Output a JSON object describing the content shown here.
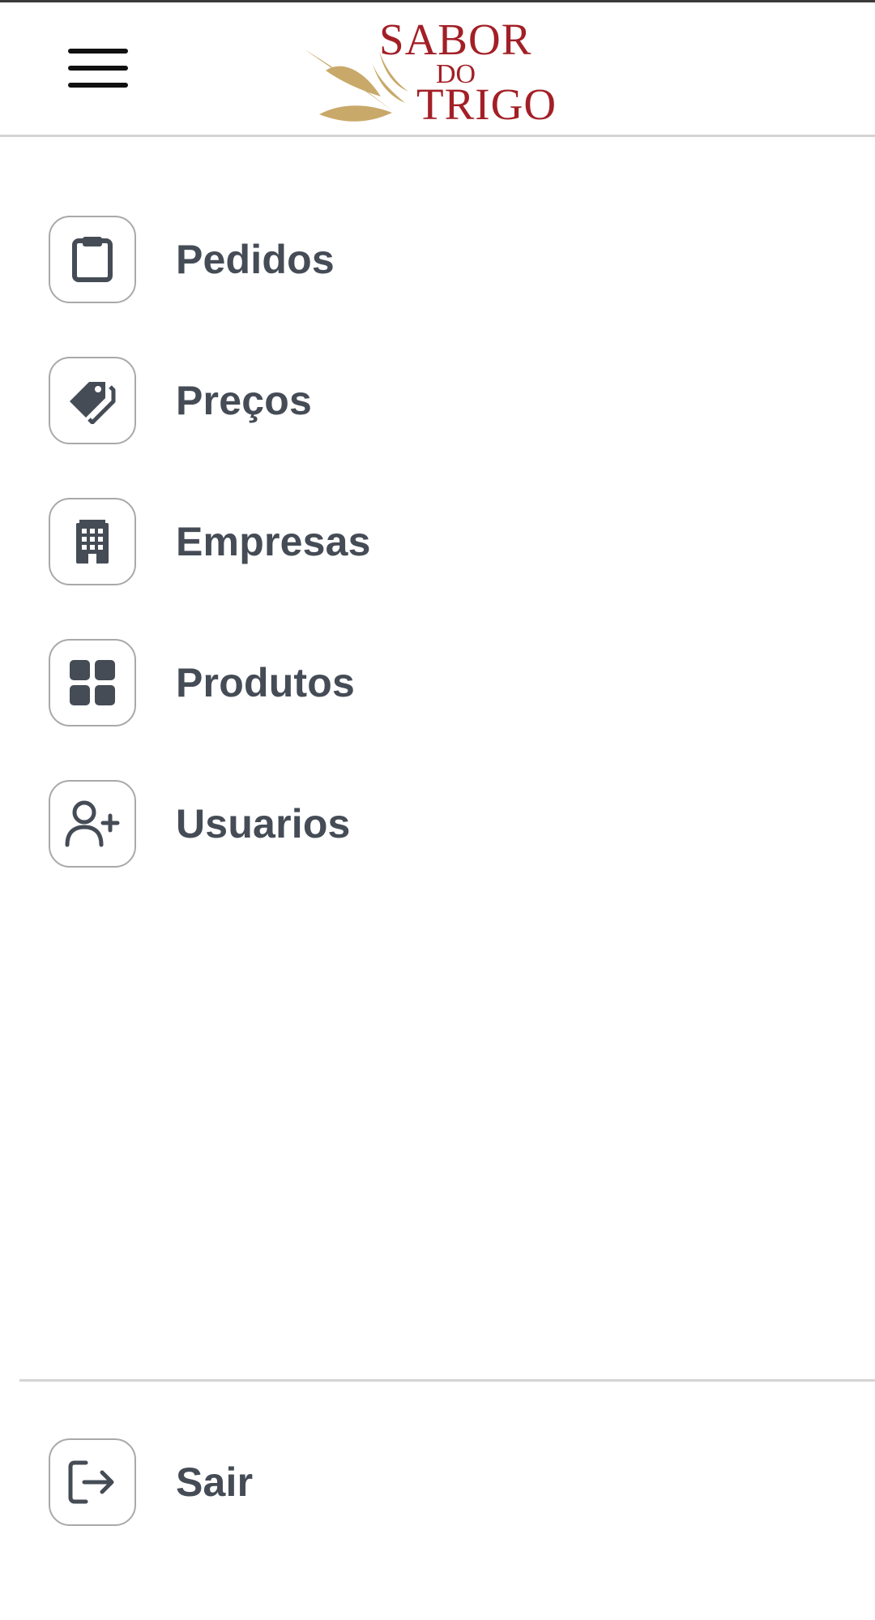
{
  "brand": {
    "line1": "SABOR",
    "line2": "DO",
    "line3": "TRIGO",
    "colors": {
      "text": "#a31f26",
      "wheat": "#c9a96a"
    }
  },
  "menu": {
    "items": [
      {
        "label": "Pedidos",
        "icon": "clipboard-icon"
      },
      {
        "label": "Preços",
        "icon": "tag-icon"
      },
      {
        "label": "Empresas",
        "icon": "building-icon"
      },
      {
        "label": "Produtos",
        "icon": "grid-icon"
      },
      {
        "label": "Usuarios",
        "icon": "user-plus-icon"
      }
    ],
    "logout": {
      "label": "Sair",
      "icon": "logout-icon"
    }
  },
  "colors": {
    "label": "#454c56",
    "icon": "#454c56",
    "border": "#a9a9a9",
    "divider": "#d4d4d4"
  }
}
